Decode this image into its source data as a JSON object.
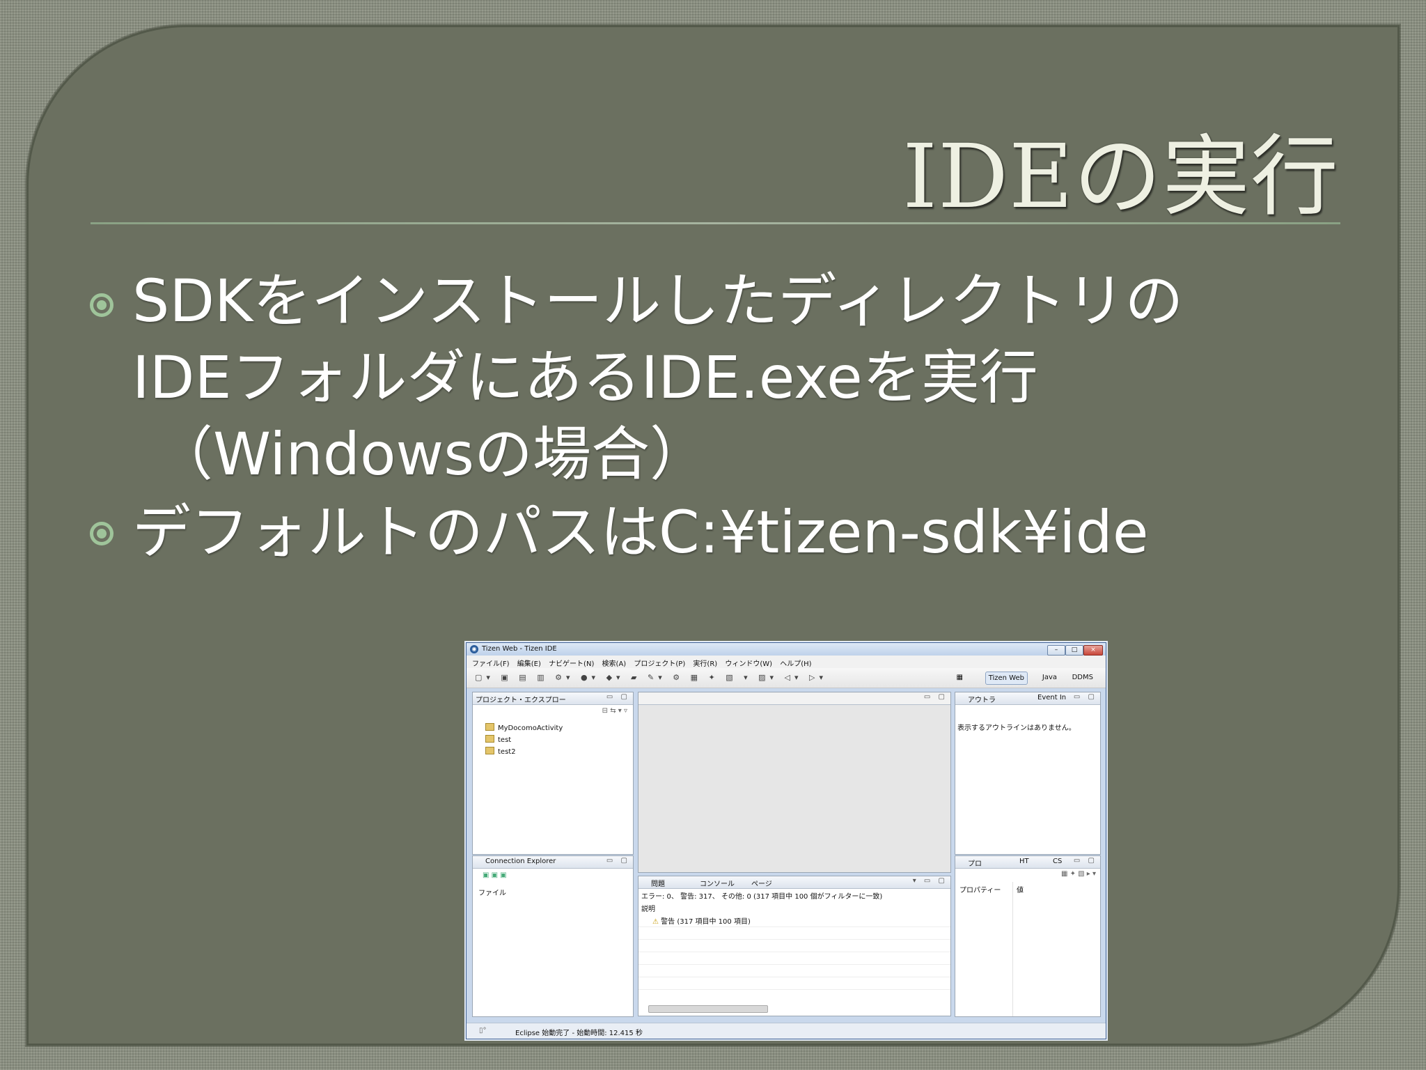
{
  "slide": {
    "title": "IDEの実行",
    "bullets": [
      {
        "lines": [
          "SDKをインストールしたディレクトリの",
          "IDEフォルダにあるIDE.exeを実行",
          "（Windowsの場合）"
        ]
      },
      {
        "lines": [
          "デフォルトのパスはC:¥tizen-sdk¥ide"
        ]
      }
    ]
  },
  "ide": {
    "window_title": "Tizen Web - Tizen IDE",
    "menu": [
      "ファイル(F)",
      "編集(E)",
      "ナビゲート(N)",
      "検索(A)",
      "プロジェクト(P)",
      "実行(R)",
      "ウィンドウ(W)",
      "ヘルプ(H)"
    ],
    "perspectives": [
      "Tizen Web",
      "Java",
      "DDMS"
    ],
    "project_explorer": {
      "tab": "プロジェクト・エクスプロー",
      "items": [
        "MyDocomoActivity",
        "test",
        "test2"
      ]
    },
    "outline": {
      "tabs": [
        "アウトラ",
        "Event In"
      ],
      "message": "表示するアウトラインはありません。"
    },
    "connection_explorer": {
      "tab": "Connection Explorer",
      "column": "ファイル"
    },
    "problems": {
      "tabs": [
        "問題",
        "コンソール",
        "ページ"
      ],
      "summary": "エラー: 0、 警告: 317、 その他: 0 (317 項目中 100 個がフィルターに一致)",
      "column": "説明",
      "row": "警告 (317 項目中 100 項目)"
    },
    "properties": {
      "tabs": [
        "プロ",
        "HT",
        "CS"
      ],
      "col1": "プロパティー",
      "col2": "値"
    },
    "status": "Eclipse 始動完了 - 始動時間: 12.415 秒"
  },
  "colors": {
    "panel": "#6b7060",
    "title_text": "#eef0e2",
    "bullet": "#9fc49a",
    "rule": "#a7b4a0"
  },
  "icons": [
    "bullet-icon",
    "gear-icon",
    "folder-icon",
    "warning-icon",
    "minimize-icon",
    "maximize-icon",
    "close-icon"
  ]
}
